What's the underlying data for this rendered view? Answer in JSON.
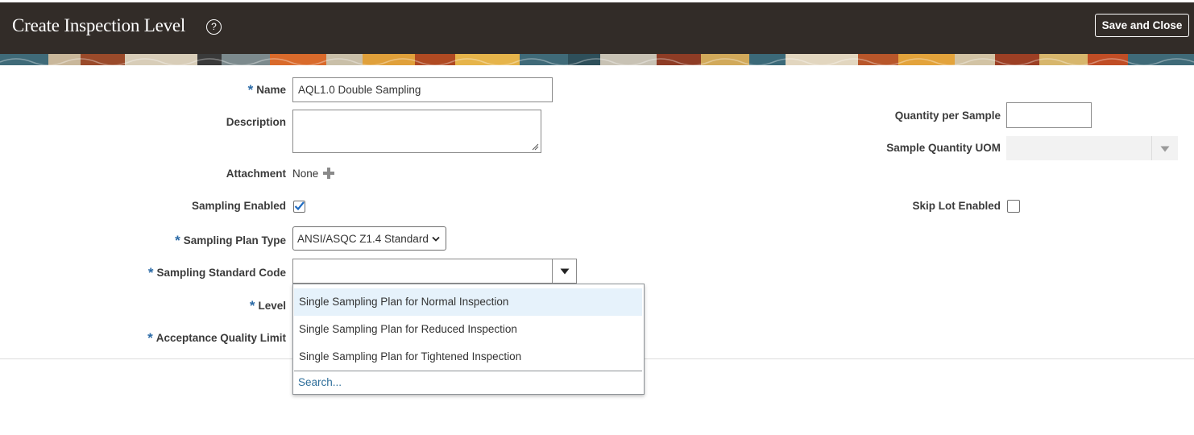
{
  "header": {
    "title": "Create Inspection Level",
    "help_icon": "?",
    "save_and_close": "Save and Close"
  },
  "form": {
    "name": {
      "label": "Name",
      "value": "AQL1.0 Double Sampling"
    },
    "description": {
      "label": "Description",
      "value": ""
    },
    "attachment": {
      "label": "Attachment",
      "value": "None",
      "add_icon": "plus-icon"
    },
    "sampling_enabled": {
      "label": "Sampling Enabled",
      "checked": true
    },
    "sampling_plan_type": {
      "label": "Sampling Plan Type",
      "value": "ANSI/ASQC Z1.4 Standard"
    },
    "sampling_standard_code": {
      "label": "Sampling Standard Code",
      "value": ""
    },
    "level": {
      "label": "Level"
    },
    "acceptance_quality_limit": {
      "label": "Acceptance Quality Limit"
    },
    "quantity_per_sample": {
      "label": "Quantity per Sample",
      "value": ""
    },
    "sample_quantity_uom": {
      "label": "Sample Quantity UOM",
      "value": ""
    },
    "skip_lot_enabled": {
      "label": "Skip Lot Enabled",
      "checked": false
    }
  },
  "dropdown": {
    "options": [
      "Single Sampling Plan for Normal Inspection",
      "Single Sampling Plan for Reduced Inspection",
      "Single Sampling Plan for Tightened Inspection"
    ],
    "search_link": "Search..."
  },
  "colors": {
    "header_bg": "#322c28",
    "required_asterisk": "#2b6aa6",
    "checkmark": "#1f6bc1",
    "highlight": "#e6f2fb",
    "link": "#2f6f9b"
  }
}
